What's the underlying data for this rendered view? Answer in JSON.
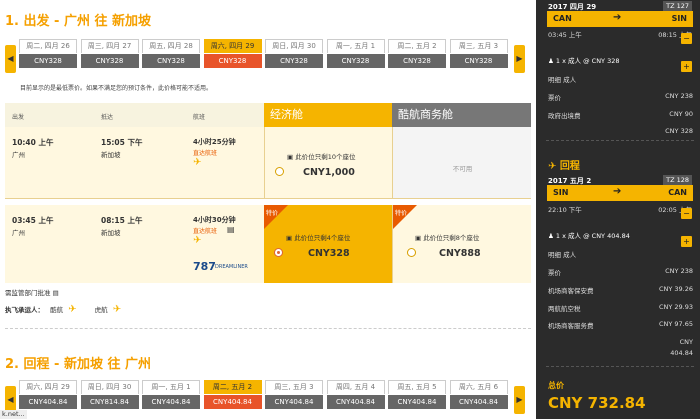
{
  "outbound": {
    "header_num": "1.",
    "header_dir": "出发 -",
    "header_route": "广州 往 新加坡",
    "dates": [
      {
        "day": "周二, 四月 26",
        "price": "CNY328"
      },
      {
        "day": "周三, 四月 27",
        "price": "CNY328"
      },
      {
        "day": "周五, 四月 28",
        "price": "CNY328"
      },
      {
        "day": "周六, 四月 29",
        "price": "CNY328",
        "selected": true
      },
      {
        "day": "周日, 四月 30",
        "price": "CNY328"
      },
      {
        "day": "周一, 五月 1",
        "price": "CNY328"
      },
      {
        "day": "周二, 五月 2",
        "price": "CNY328"
      },
      {
        "day": "周三, 五月 3",
        "price": "CNY328"
      }
    ],
    "note": "目前显示的是最低票价。如果不满足您的预订条件，此价格可能不适用。",
    "table_headers": {
      "depart": "出发",
      "arrive": "抵达",
      "flight": "航班"
    },
    "cabin_eco": "经济舱",
    "cabin_biz": "酷航商务舱",
    "flights": [
      {
        "dep_time": "10:40 上午",
        "dep_city": "广州",
        "arr_time": "15:05 下午",
        "arr_city": "新加坡",
        "duration": "4小时25分钟",
        "direct": "直达航班",
        "eco_seats": "此价位只剩10个座位",
        "eco_price": "CNY1,000",
        "biz_na": "不可用"
      },
      {
        "dep_time": "03:45 上午",
        "dep_city": "广州",
        "arr_time": "08:15 上午",
        "arr_city": "新加坡",
        "duration": "4小时30分钟",
        "direct": "直达航班",
        "aircraft": "787",
        "aircraft_brand": "DREAMLINER",
        "eco_tag": "特价",
        "eco_seats": "此价位只剩4个座位",
        "eco_price": "CNY328",
        "biz_tag": "特价",
        "biz_seats": "此价位只剩8个座位",
        "biz_price": "CNY888"
      }
    ],
    "footer_approval": "需监管部门批准",
    "footer_carrier": "执飞承运人：",
    "carrier1": "酷航",
    "carrier2": "虎航"
  },
  "return": {
    "header_num": "2.",
    "header_dir": "回程 -",
    "header_route": "新加坡 往 广州",
    "dates": [
      {
        "day": "周六, 四月 29",
        "price": "CNY404.84"
      },
      {
        "day": "周日, 四月 30",
        "price": "CNY814.84"
      },
      {
        "day": "周一, 五月 1",
        "price": "CNY404.84"
      },
      {
        "day": "周二, 五月 2",
        "price": "CNY404.84",
        "selected": true
      },
      {
        "day": "周三, 五月 3",
        "price": "CNY404.84"
      },
      {
        "day": "周四, 五月 4",
        "price": "CNY404.84"
      },
      {
        "day": "周五, 五月 5",
        "price": "CNY404.84"
      },
      {
        "day": "周六, 五月 6",
        "price": "CNY404.84"
      }
    ]
  },
  "status_text": "k.net...",
  "sidebar": {
    "out": {
      "date": "2017 四月 29",
      "flight": "TZ 127",
      "from": "CAN",
      "to": "SIN",
      "dep": "03:45 上午",
      "arr": "08:15 上午",
      "pax": "1 x 成人 @ CNY 328",
      "detail_title": "明细 成人",
      "rows": [
        {
          "label": "票价",
          "value": "CNY 238"
        },
        {
          "label": "政府出境费",
          "value": "CNY 90"
        }
      ],
      "subtotal": "CNY 328"
    },
    "ret_title": "回程",
    "ret": {
      "date": "2017 五月 2",
      "flight": "TZ 128",
      "from": "SIN",
      "to": "CAN",
      "dep": "22:10 下午",
      "arr": "02:05 上午",
      "pax": "1 x 成人 @ CNY 404.84",
      "detail_title": "明细 成人",
      "rows": [
        {
          "label": "票价",
          "value": "CNY 238"
        },
        {
          "label": "机场商客保安费",
          "value": "CNY 39.26"
        },
        {
          "label": "两航航空税",
          "value": "CNY 29.93"
        },
        {
          "label": "机场商客服务费",
          "value": "CNY 97.65"
        }
      ],
      "subtotal_a": "CNY",
      "subtotal_b": "404.84"
    },
    "total_label": "总价",
    "total_value": "CNY 732.84"
  },
  "icons": {
    "prev": "chevron-left-icon",
    "next": "chevron-right-icon",
    "plane": "plane-icon",
    "seat": "seat-icon",
    "edit": "edit-icon"
  },
  "colors": {
    "accent": "#f5b400",
    "title": "#f5a000",
    "selected_price": "#e8542a",
    "sidebar_bg": "#2b2b2b"
  }
}
